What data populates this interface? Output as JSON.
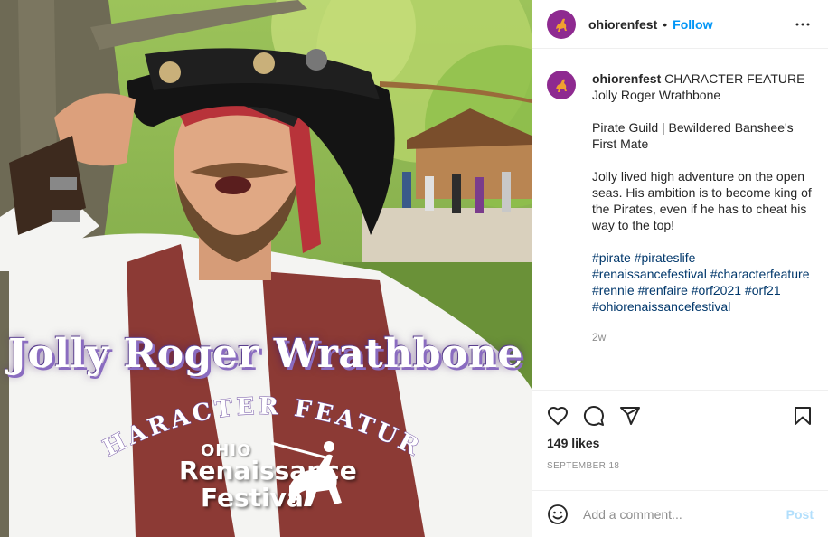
{
  "post": {
    "image": {
      "title_overlay": "Jolly Roger Wrathbone",
      "subtitle_overlay": "CHARACTER FEATURE",
      "logo_line1": "OHIO",
      "logo_line2": "Renaissance",
      "logo_line3": "Festival"
    },
    "header": {
      "username": "ohiorenfest",
      "separator": "•",
      "follow_label": "Follow",
      "more_icon": "more-horizontal-icon"
    },
    "caption": {
      "username": "ohiorenfest",
      "paragraph1": "CHARACTER FEATURE Jolly Roger Wrathbone",
      "paragraph2": "Pirate Guild | Bewildered Banshee's First Mate",
      "paragraph3": "Jolly lived high adventure on the open seas. His ambition is to become king of the Pirates, even if he has to cheat his way to the top!",
      "hashtags": [
        "#pirate",
        "#pirateslife",
        "#renaissancefestival",
        "#characterfeature",
        "#rennie",
        "#renfaire",
        "#orf2021",
        "#orf21",
        "#ohiorenaissancefestival"
      ],
      "time_ago": "2w"
    },
    "actions": {
      "like_icon": "heart-icon",
      "comment_icon": "comment-icon",
      "share_icon": "send-icon",
      "save_icon": "bookmark-icon"
    },
    "likes_text": "149 likes",
    "date_text": "SEPTEMBER 18",
    "comment": {
      "placeholder": "Add a comment...",
      "post_label": "Post",
      "emoji_icon": "smiley-icon"
    }
  },
  "colors": {
    "accent": "#0095f6",
    "link": "#00376b",
    "muted": "#8e8e8e",
    "post_disabled": "#b2dffc",
    "avatar_bg": "#8e2a90",
    "overlay_shadow": "#8a6cc0"
  }
}
